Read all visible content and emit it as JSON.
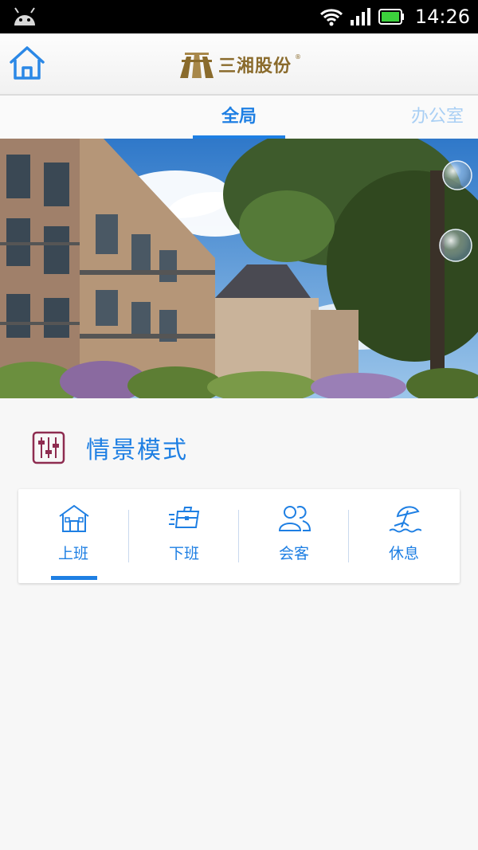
{
  "status_bar": {
    "time": "14:26",
    "icons": [
      "android-icon",
      "wifi-icon",
      "signal-icon",
      "battery-icon"
    ]
  },
  "header": {
    "home_icon": "home-icon",
    "logo_text": "三湘股份",
    "logo_reg": "®"
  },
  "tabs": [
    {
      "label": "全局",
      "active": true
    },
    {
      "label": "办公室",
      "active": false
    }
  ],
  "section": {
    "title": "情景模式",
    "icon": "sliders-icon"
  },
  "scenes": [
    {
      "label": "上班",
      "icon": "house-icon",
      "selected": true
    },
    {
      "label": "下班",
      "icon": "briefcase-icon",
      "selected": false
    },
    {
      "label": "会客",
      "icon": "people-icon",
      "selected": false
    },
    {
      "label": "休息",
      "icon": "beach-umbrella-icon",
      "selected": false
    }
  ],
  "colors": {
    "accent": "#1e7fe3",
    "logo": "#8a6b2c",
    "section_icon": "#8e2c50"
  }
}
